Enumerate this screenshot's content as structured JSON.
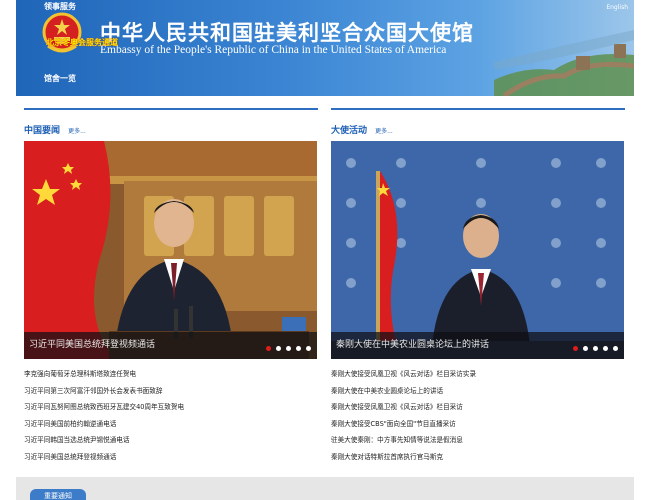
{
  "header": {
    "title_cn": "中华人民共和国驻美利坚合众国大使馆",
    "title_en": "Embassy of the People's Republic of China in the United States of America",
    "language_link": "English",
    "nav": {
      "consular": "领事服务",
      "business": "北京冬奥会服务通道",
      "overview": "馆舍一览"
    }
  },
  "left_column": {
    "heading": "中国要闻",
    "more": "更多...",
    "caption": "习近平同美国总统拜登视频通话",
    "slides": 5,
    "active_slide": 0,
    "items": [
      "李克强向葡萄牙总理科斯塔致连任贺电",
      "习近平同第三次阿富汗邻国外长会发表书面致辞",
      "习近平同瓦努阿图总统致西班牙瓦建交40周年互致贺电",
      "习近平同美国前柏约翰逆通电话",
      "习近平同韩国当选总统尹锡悦通电话",
      "习近平同美国总统拜登视频通话"
    ]
  },
  "right_column": {
    "heading": "大使活动",
    "more": "更多...",
    "caption": "秦刚大使在中美农业圆桌论坛上的讲话",
    "slides": 5,
    "active_slide": 0,
    "items": [
      "秦刚大使接受凤凰卫视《风云对话》栏目采访实录",
      "秦刚大使在中美农业圆桌论坛上的讲话",
      "秦刚大使接受凤凰卫视《风云对话》栏目采访",
      "秦刚大使接受CBS\"面向全国\"节目直播采访",
      "驻美大使秦刚：中方事先知情等说法是假消息",
      "秦刚大使对话特斯拉首席执行官马斯克"
    ]
  },
  "bottom": {
    "tab_label": "重要通知"
  },
  "colors": {
    "brand_blue": "#2d6ec2",
    "flag_red": "#d81e1e"
  }
}
